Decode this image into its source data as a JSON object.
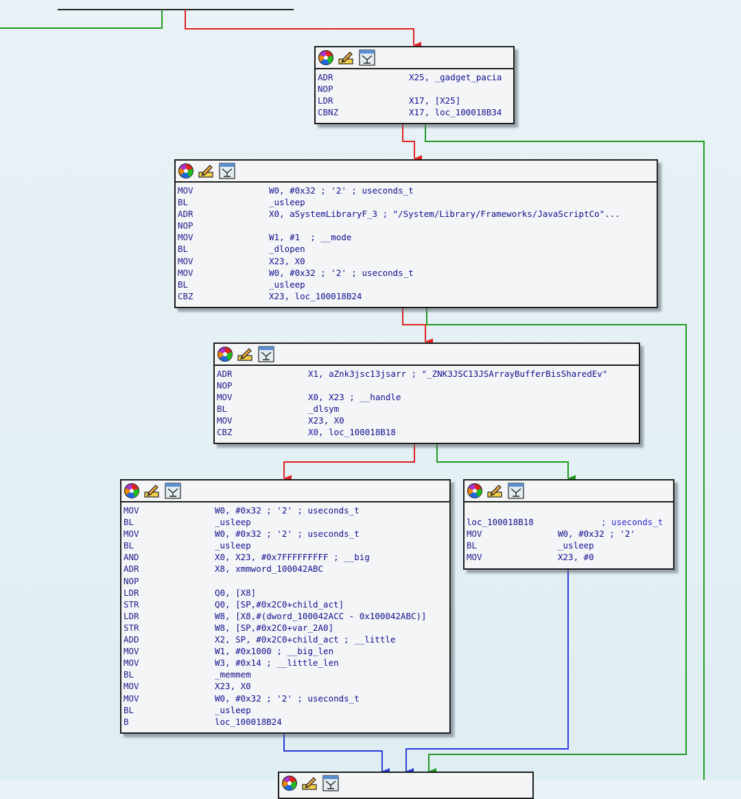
{
  "colors": {
    "true_edge": "#1e9a1e",
    "false_edge": "#e12020",
    "jump_edge": "#2a3ae0",
    "mnemonic": "#1c1c8c",
    "operand": "#101090",
    "comment": "#2c2cd0",
    "block_bg": "#f4f5f6",
    "background": "#e4f0f4"
  },
  "header_icons": [
    "color-palette-icon",
    "rename-pencil-icon",
    "graph-overview-icon"
  ],
  "blocks": [
    {
      "id": "block-1",
      "lines": [
        {
          "mn": "ADR",
          "ops": "X25, _gadget_pacia"
        },
        {
          "mn": "NOP",
          "ops": ""
        },
        {
          "mn": "LDR",
          "ops": "X17, [X25]"
        },
        {
          "mn": "CBNZ",
          "ops": "X17, loc_100018B34"
        }
      ]
    },
    {
      "id": "block-2",
      "lines": [
        {
          "mn": "MOV",
          "ops": "W0, #0x32 ; '2' ; useconds_t"
        },
        {
          "mn": "BL",
          "ops": "_usleep"
        },
        {
          "mn": "ADR",
          "ops": "X0, aSystemLibraryF_3 ; \"/System/Library/Frameworks/JavaScriptCo\"..."
        },
        {
          "mn": "NOP",
          "ops": ""
        },
        {
          "mn": "MOV",
          "ops": "W1, #1  ; __mode"
        },
        {
          "mn": "BL",
          "ops": "_dlopen"
        },
        {
          "mn": "MOV",
          "ops": "X23, X0"
        },
        {
          "mn": "MOV",
          "ops": "W0, #0x32 ; '2' ; useconds_t"
        },
        {
          "mn": "BL",
          "ops": "_usleep"
        },
        {
          "mn": "CBZ",
          "ops": "X23, loc_100018B24"
        }
      ]
    },
    {
      "id": "block-3",
      "lines": [
        {
          "mn": "ADR",
          "ops": "X1, aZnk3jsc13jsarr ; \"_ZNK3JSC13JSArrayBufferBisSharedEv\""
        },
        {
          "mn": "NOP",
          "ops": ""
        },
        {
          "mn": "MOV",
          "ops": "X0, X23 ; __handle"
        },
        {
          "mn": "BL",
          "ops": "_dlsym"
        },
        {
          "mn": "MOV",
          "ops": "X23, X0"
        },
        {
          "mn": "CBZ",
          "ops": "X0, loc_100018B18"
        }
      ]
    },
    {
      "id": "block-4",
      "lines": [
        {
          "mn": "MOV",
          "ops": "W0, #0x32 ; '2' ; useconds_t"
        },
        {
          "mn": "BL",
          "ops": "_usleep"
        },
        {
          "mn": "MOV",
          "ops": "W0, #0x32 ; '2' ; useconds_t"
        },
        {
          "mn": "BL",
          "ops": "_usleep"
        },
        {
          "mn": "AND",
          "ops": "X0, X23, #0x7FFFFFFFFF ; __big"
        },
        {
          "mn": "ADR",
          "ops": "X8, xmmword_100042ABC"
        },
        {
          "mn": "NOP",
          "ops": ""
        },
        {
          "mn": "LDR",
          "ops": "Q0, [X8]"
        },
        {
          "mn": "STR",
          "ops": "Q0, [SP,#0x2C0+child_act]"
        },
        {
          "mn": "LDR",
          "ops": "W8, [X8,#(dword_100042ACC - 0x100042ABC)]"
        },
        {
          "mn": "STR",
          "ops": "W8, [SP,#0x2C0+var_2A0]"
        },
        {
          "mn": "ADD",
          "ops": "X2, SP, #0x2C0+child_act ; __little"
        },
        {
          "mn": "MOV",
          "ops": "W1, #0x1000 ; __big_len"
        },
        {
          "mn": "MOV",
          "ops": "W3, #0x14 ; __little_len"
        },
        {
          "mn": "BL",
          "ops": "_memmem"
        },
        {
          "mn": "MOV",
          "ops": "X23, X0"
        },
        {
          "mn": "MOV",
          "ops": "W0, #0x32 ; '2' ; useconds_t"
        },
        {
          "mn": "BL",
          "ops": "_usleep"
        },
        {
          "mn": "B",
          "ops": "loc_100018B24"
        }
      ]
    },
    {
      "id": "block-5",
      "label": "loc_100018B18",
      "label_comment": "; useconds_t",
      "lines": [
        {
          "mn": "MOV",
          "ops": "W0, #0x32 ; '2'"
        },
        {
          "mn": "BL",
          "ops": "_usleep"
        },
        {
          "mn": "MOV",
          "ops": "X23, #0"
        }
      ]
    }
  ]
}
